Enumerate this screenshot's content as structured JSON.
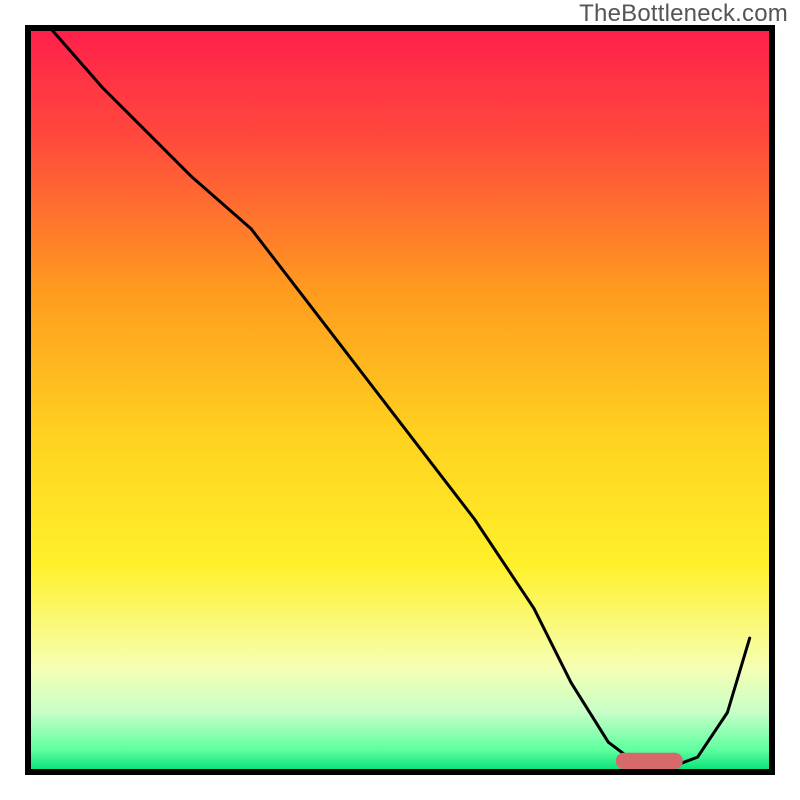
{
  "branding": {
    "watermark": "TheBottleneck.com"
  },
  "chart_data": {
    "type": "line",
    "title": "",
    "xlabel": "",
    "ylabel": "",
    "xlim": [
      0,
      100
    ],
    "ylim": [
      0,
      100
    ],
    "grid": false,
    "legend": false,
    "background_gradient": {
      "stops": [
        {
          "offset": 0.0,
          "color": "#ff1f4b"
        },
        {
          "offset": 0.15,
          "color": "#ff4a3c"
        },
        {
          "offset": 0.35,
          "color": "#ff9a1f"
        },
        {
          "offset": 0.55,
          "color": "#ffd21f"
        },
        {
          "offset": 0.72,
          "color": "#fff02a"
        },
        {
          "offset": 0.86,
          "color": "#f6ffb3"
        },
        {
          "offset": 0.92,
          "color": "#c7ffc7"
        },
        {
          "offset": 0.97,
          "color": "#5fff9f"
        },
        {
          "offset": 1.0,
          "color": "#00e076"
        }
      ]
    },
    "series": [
      {
        "name": "bottleneck-curve",
        "color": "#000000",
        "x": [
          3,
          10,
          22,
          30,
          40,
          50,
          60,
          68,
          73,
          78,
          82,
          86,
          90,
          94,
          97
        ],
        "y": [
          100,
          92,
          80,
          73,
          60,
          47,
          34,
          22,
          12,
          4,
          1,
          0.5,
          2,
          8,
          18
        ]
      }
    ],
    "marker": {
      "name": "optimal-range",
      "color": "#d66a6a",
      "x_start": 79,
      "x_end": 88,
      "y": 1.5,
      "thickness": 2.2
    }
  }
}
